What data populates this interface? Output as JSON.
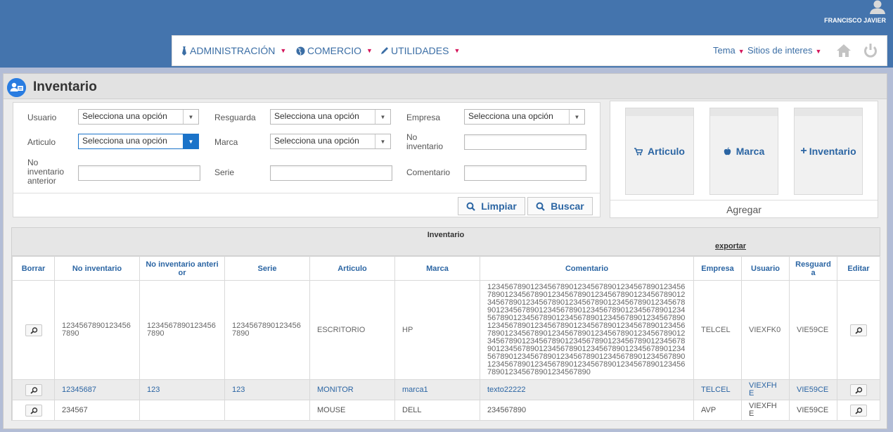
{
  "user": {
    "name": "FRANCISCO JAVIER"
  },
  "nav": {
    "admin": "ADMINISTRACIÓN",
    "comercio": "COMERCIO",
    "utilidades": "UTILIDADES",
    "tema": "Tema",
    "sitios": "Sitios de interes"
  },
  "page": {
    "title": "Inventario"
  },
  "filters": {
    "usuario_label": "Usuario",
    "usuario_value": "Selecciona una opción",
    "resguarda_label": "Resguarda",
    "resguarda_value": "Selecciona una opción",
    "empresa_label": "Empresa",
    "empresa_value": "Selecciona una opción",
    "articulo_label": "Articulo",
    "articulo_value": "Selecciona una opción",
    "marca_label": "Marca",
    "marca_value": "Selecciona una opción",
    "no_inv_label_1": "No",
    "no_inv_label_2": "inventario",
    "no_inv_ant_label_1": "No",
    "no_inv_ant_label_2": "inventario",
    "no_inv_ant_label_3": "anterior",
    "serie_label": "Serie",
    "comentario_label": "Comentario",
    "limpiar": "Limpiar",
    "buscar": "Buscar"
  },
  "add": {
    "articulo": "Articulo",
    "marca": "Marca",
    "inventario": "Inventario",
    "footer": "Agregar"
  },
  "table": {
    "caption": "Inventario",
    "export": "exportar",
    "headers": [
      "Borrar",
      "No inventario",
      "No inventario anterior",
      "Serie",
      "Articulo",
      "Marca",
      "Comentario",
      "Empresa",
      "Usuario",
      "Resguarda",
      "Editar"
    ],
    "rows": [
      [
        "",
        "12345678901234567890",
        "12345678901234567890",
        "12345678901234567890",
        "ESCRITORIO",
        "HP",
        "12345678901234567890123456789012345678901234567890123456789012345678901234567890123456789012345678901234567890123456789012345678901234567890123456789012345678901234567890123456789012345678901234567890123456789012345678901234567890123456789012345678901234567890123456789012345678901234567890123456789012345678901234567890123456789012345678901234567890123456789012345678901234567890123456789012345678901234567890123456789012345678901234567890123456789012345678901234567890123456789012345678901234567890123456789012345678901234567890",
        "TELCEL",
        "VIEXFK0",
        "VIE59CE",
        ""
      ],
      [
        "",
        "12345687",
        "123",
        "123",
        "MONITOR",
        "marca1",
        "texto22222",
        "TELCEL",
        "VIEXFHE",
        "VIE59CE",
        ""
      ],
      [
        "",
        "234567",
        "",
        "",
        "MOUSE",
        "DELL",
        "234567890",
        "AVP",
        "VIEXFHE",
        "VIE59CE",
        ""
      ]
    ]
  }
}
